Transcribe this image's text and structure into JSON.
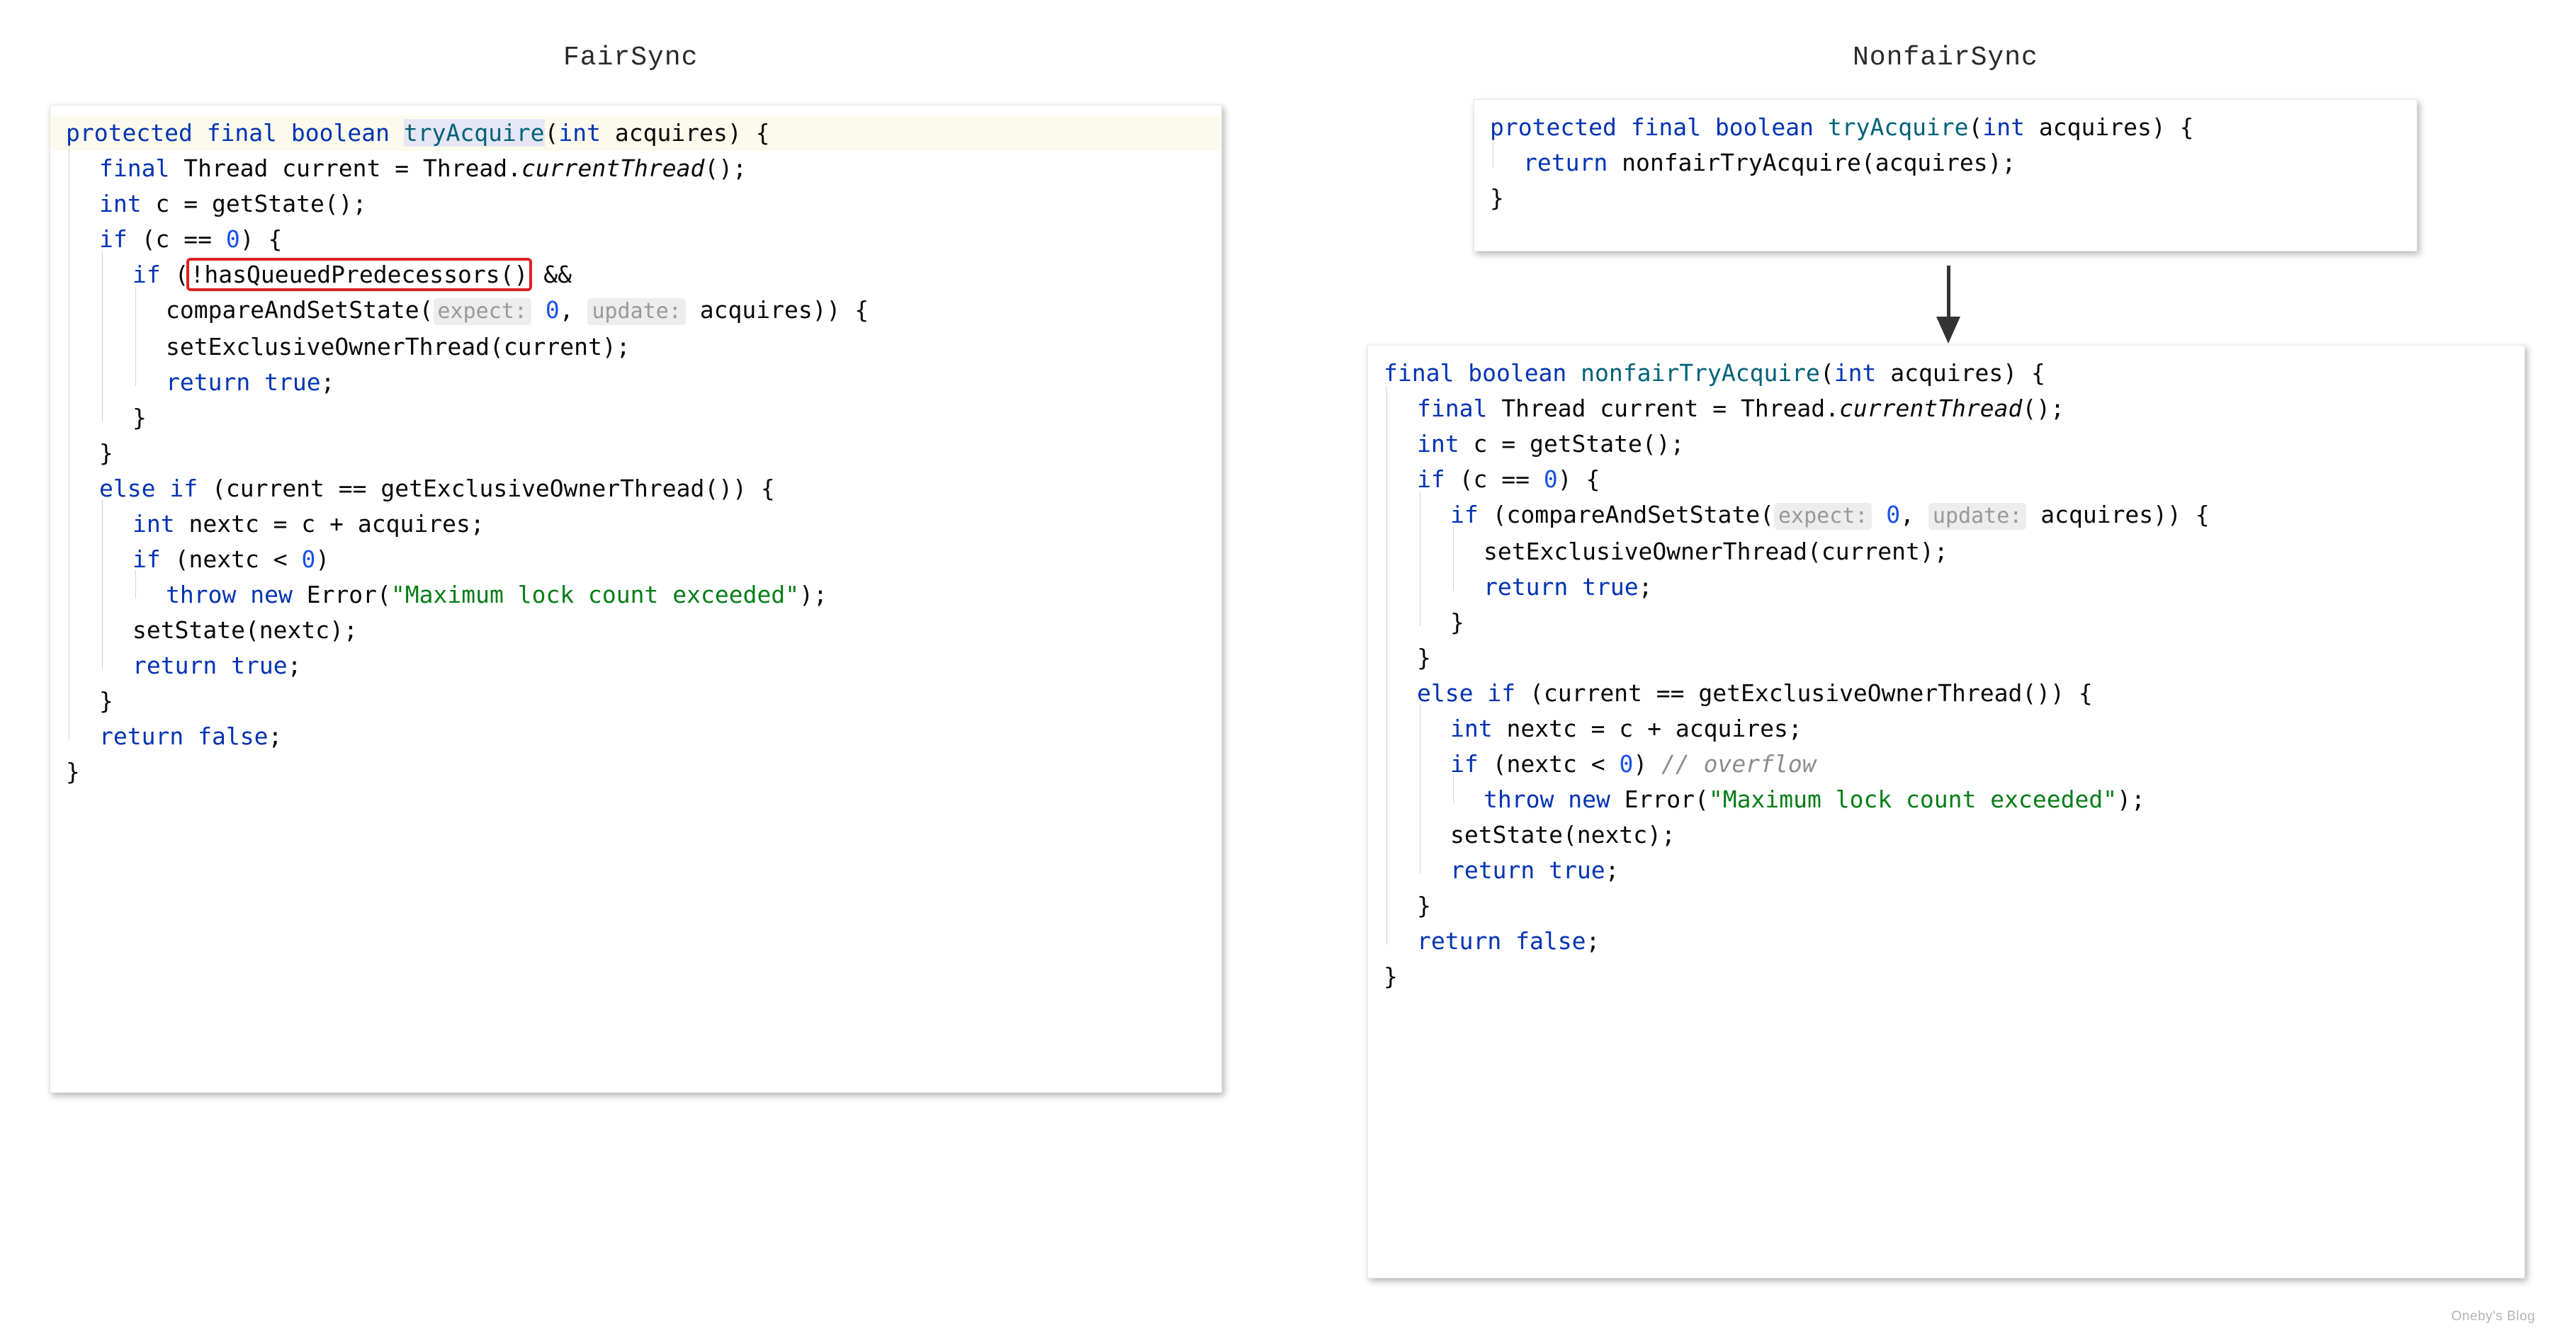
{
  "page": {
    "watermark": "Oneby's Blog",
    "colors": {
      "keyword": "#0033b3",
      "method": "#00627a",
      "number": "#1750eb",
      "string": "#067d17",
      "comment": "#8c8c8c",
      "annotation_box": "#e02020",
      "line_highlight": "#fcfaec",
      "word_highlight": "#e6e6f5",
      "hint_background": "#ededed",
      "hint_text": "#999999",
      "arrow": "#333333",
      "page_background": "#ffffff"
    }
  },
  "left_panel": {
    "title": "FairSync",
    "code_lines": [
      {
        "highlight": true,
        "indent": 0,
        "tokens": [
          {
            "t": "protected",
            "c": "kw"
          },
          {
            "t": " ",
            "c": "plain"
          },
          {
            "t": "final",
            "c": "kw"
          },
          {
            "t": " ",
            "c": "plain"
          },
          {
            "t": "boolean",
            "c": "kw"
          },
          {
            "t": " ",
            "c": "plain"
          },
          {
            "t": "tryAcquire",
            "c": "meth",
            "hl": true
          },
          {
            "t": "(",
            "c": "plain"
          },
          {
            "t": "int",
            "c": "kw"
          },
          {
            "t": " acquires) {",
            "c": "plain"
          }
        ]
      },
      {
        "highlight": false,
        "indent": 1,
        "tokens": [
          {
            "t": "final",
            "c": "kw"
          },
          {
            "t": " Thread current = Thread.",
            "c": "plain"
          },
          {
            "t": "currentThread",
            "c": "plain",
            "italic": true
          },
          {
            "t": "();",
            "c": "plain"
          }
        ]
      },
      {
        "highlight": false,
        "indent": 1,
        "tokens": [
          {
            "t": "int",
            "c": "kw"
          },
          {
            "t": " c = getState();",
            "c": "plain"
          }
        ]
      },
      {
        "highlight": false,
        "indent": 1,
        "tokens": [
          {
            "t": "if",
            "c": "kw"
          },
          {
            "t": " (c == ",
            "c": "plain"
          },
          {
            "t": "0",
            "c": "num"
          },
          {
            "t": ") {",
            "c": "plain"
          }
        ]
      },
      {
        "highlight": false,
        "indent": 2,
        "tokens": [
          {
            "t": "if",
            "c": "kw"
          },
          {
            "t": " (",
            "c": "plain"
          },
          {
            "t": "!hasQueuedPredecessors()",
            "c": "plain",
            "redbox": true
          },
          {
            "t": " &&",
            "c": "plain"
          }
        ]
      },
      {
        "highlight": false,
        "indent": 3,
        "tokens": [
          {
            "t": "compareAndSetState(",
            "c": "plain"
          },
          {
            "t": "expect:",
            "c": "hint"
          },
          {
            "t": " ",
            "c": "plain"
          },
          {
            "t": "0",
            "c": "num"
          },
          {
            "t": ", ",
            "c": "plain"
          },
          {
            "t": "update:",
            "c": "hint"
          },
          {
            "t": " acquires)) {",
            "c": "plain"
          }
        ]
      },
      {
        "highlight": false,
        "indent": 3,
        "tokens": [
          {
            "t": "setExclusiveOwnerThread(current);",
            "c": "plain"
          }
        ]
      },
      {
        "highlight": false,
        "indent": 3,
        "tokens": [
          {
            "t": "return",
            "c": "kw"
          },
          {
            "t": " ",
            "c": "plain"
          },
          {
            "t": "true",
            "c": "kw"
          },
          {
            "t": ";",
            "c": "plain"
          }
        ]
      },
      {
        "highlight": false,
        "indent": 2,
        "tokens": [
          {
            "t": "}",
            "c": "plain"
          }
        ]
      },
      {
        "highlight": false,
        "indent": 1,
        "tokens": [
          {
            "t": "}",
            "c": "plain"
          }
        ]
      },
      {
        "highlight": false,
        "indent": 1,
        "tokens": [
          {
            "t": "else",
            "c": "kw"
          },
          {
            "t": " ",
            "c": "plain"
          },
          {
            "t": "if",
            "c": "kw"
          },
          {
            "t": " (current == getExclusiveOwnerThread()) {",
            "c": "plain"
          }
        ]
      },
      {
        "highlight": false,
        "indent": 2,
        "tokens": [
          {
            "t": "int",
            "c": "kw"
          },
          {
            "t": " nextc = c + acquires;",
            "c": "plain"
          }
        ]
      },
      {
        "highlight": false,
        "indent": 2,
        "tokens": [
          {
            "t": "if",
            "c": "kw"
          },
          {
            "t": " (nextc < ",
            "c": "plain"
          },
          {
            "t": "0",
            "c": "num"
          },
          {
            "t": ")",
            "c": "plain"
          }
        ]
      },
      {
        "highlight": false,
        "indent": 3,
        "tokens": [
          {
            "t": "throw",
            "c": "kw"
          },
          {
            "t": " ",
            "c": "plain"
          },
          {
            "t": "new",
            "c": "kw"
          },
          {
            "t": " Error(",
            "c": "plain"
          },
          {
            "t": "\"Maximum lock count exceeded\"",
            "c": "str"
          },
          {
            "t": ");",
            "c": "plain"
          }
        ]
      },
      {
        "highlight": false,
        "indent": 2,
        "tokens": [
          {
            "t": "setState(nextc);",
            "c": "plain"
          }
        ]
      },
      {
        "highlight": false,
        "indent": 2,
        "tokens": [
          {
            "t": "return",
            "c": "kw"
          },
          {
            "t": " ",
            "c": "plain"
          },
          {
            "t": "true",
            "c": "kw"
          },
          {
            "t": ";",
            "c": "plain"
          }
        ]
      },
      {
        "highlight": false,
        "indent": 1,
        "tokens": [
          {
            "t": "}",
            "c": "plain"
          }
        ]
      },
      {
        "highlight": false,
        "indent": 1,
        "tokens": [
          {
            "t": "return",
            "c": "kw"
          },
          {
            "t": " ",
            "c": "plain"
          },
          {
            "t": "false",
            "c": "kw"
          },
          {
            "t": ";",
            "c": "plain"
          }
        ]
      },
      {
        "highlight": false,
        "indent": 0,
        "tokens": [
          {
            "t": "}",
            "c": "plain"
          }
        ]
      }
    ]
  },
  "right_panel": {
    "title": "NonfairSync",
    "top_card_lines": [
      {
        "highlight": false,
        "indent": 0,
        "tokens": [
          {
            "t": "protected",
            "c": "kw"
          },
          {
            "t": " ",
            "c": "plain"
          },
          {
            "t": "final",
            "c": "kw"
          },
          {
            "t": " ",
            "c": "plain"
          },
          {
            "t": "boolean",
            "c": "kw"
          },
          {
            "t": " ",
            "c": "plain"
          },
          {
            "t": "tryAcquire",
            "c": "meth"
          },
          {
            "t": "(",
            "c": "plain"
          },
          {
            "t": "int",
            "c": "kw"
          },
          {
            "t": " acquires) {",
            "c": "plain"
          }
        ]
      },
      {
        "highlight": false,
        "indent": 1,
        "tokens": [
          {
            "t": "return",
            "c": "kw"
          },
          {
            "t": " nonfairTryAcquire(acquires);",
            "c": "plain"
          }
        ]
      },
      {
        "highlight": false,
        "indent": 0,
        "tokens": [
          {
            "t": "}",
            "c": "plain"
          }
        ]
      }
    ],
    "bottom_card_lines": [
      {
        "highlight": false,
        "indent": 0,
        "tokens": [
          {
            "t": "final",
            "c": "kw"
          },
          {
            "t": " ",
            "c": "plain"
          },
          {
            "t": "boolean",
            "c": "kw"
          },
          {
            "t": " ",
            "c": "plain"
          },
          {
            "t": "nonfairTryAcquire",
            "c": "meth"
          },
          {
            "t": "(",
            "c": "plain"
          },
          {
            "t": "int",
            "c": "kw"
          },
          {
            "t": " acquires) {",
            "c": "plain"
          }
        ]
      },
      {
        "highlight": false,
        "indent": 1,
        "tokens": [
          {
            "t": "final",
            "c": "kw"
          },
          {
            "t": " Thread current = Thread.",
            "c": "plain"
          },
          {
            "t": "currentThread",
            "c": "plain",
            "italic": true
          },
          {
            "t": "();",
            "c": "plain"
          }
        ]
      },
      {
        "highlight": false,
        "indent": 1,
        "tokens": [
          {
            "t": "int",
            "c": "kw"
          },
          {
            "t": " c = getState();",
            "c": "plain"
          }
        ]
      },
      {
        "highlight": false,
        "indent": 1,
        "tokens": [
          {
            "t": "if",
            "c": "kw"
          },
          {
            "t": " (c == ",
            "c": "plain"
          },
          {
            "t": "0",
            "c": "num"
          },
          {
            "t": ") {",
            "c": "plain"
          }
        ]
      },
      {
        "highlight": false,
        "indent": 2,
        "tokens": [
          {
            "t": "if",
            "c": "kw"
          },
          {
            "t": " (compareAndSetState(",
            "c": "plain"
          },
          {
            "t": "expect:",
            "c": "hint"
          },
          {
            "t": " ",
            "c": "plain"
          },
          {
            "t": "0",
            "c": "num"
          },
          {
            "t": ", ",
            "c": "plain"
          },
          {
            "t": "update:",
            "c": "hint"
          },
          {
            "t": " acquires)) {",
            "c": "plain"
          }
        ]
      },
      {
        "highlight": false,
        "indent": 3,
        "tokens": [
          {
            "t": "setExclusiveOwnerThread(current);",
            "c": "plain"
          }
        ]
      },
      {
        "highlight": false,
        "indent": 3,
        "tokens": [
          {
            "t": "return",
            "c": "kw"
          },
          {
            "t": " ",
            "c": "plain"
          },
          {
            "t": "true",
            "c": "kw"
          },
          {
            "t": ";",
            "c": "plain"
          }
        ]
      },
      {
        "highlight": false,
        "indent": 2,
        "tokens": [
          {
            "t": "}",
            "c": "plain"
          }
        ]
      },
      {
        "highlight": false,
        "indent": 1,
        "tokens": [
          {
            "t": "}",
            "c": "plain"
          }
        ]
      },
      {
        "highlight": false,
        "indent": 1,
        "tokens": [
          {
            "t": "else",
            "c": "kw"
          },
          {
            "t": " ",
            "c": "plain"
          },
          {
            "t": "if",
            "c": "kw"
          },
          {
            "t": " (current == getExclusiveOwnerThread()) {",
            "c": "plain"
          }
        ]
      },
      {
        "highlight": false,
        "indent": 2,
        "tokens": [
          {
            "t": "int",
            "c": "kw"
          },
          {
            "t": " nextc = c + acquires;",
            "c": "plain"
          }
        ]
      },
      {
        "highlight": false,
        "indent": 2,
        "tokens": [
          {
            "t": "if",
            "c": "kw"
          },
          {
            "t": " (nextc < ",
            "c": "plain"
          },
          {
            "t": "0",
            "c": "num"
          },
          {
            "t": ") ",
            "c": "plain"
          },
          {
            "t": "// overflow",
            "c": "cmt"
          }
        ]
      },
      {
        "highlight": false,
        "indent": 3,
        "tokens": [
          {
            "t": "throw",
            "c": "kw"
          },
          {
            "t": " ",
            "c": "plain"
          },
          {
            "t": "new",
            "c": "kw"
          },
          {
            "t": " Error(",
            "c": "plain"
          },
          {
            "t": "\"Maximum lock count exceeded\"",
            "c": "str"
          },
          {
            "t": ");",
            "c": "plain"
          }
        ]
      },
      {
        "highlight": false,
        "indent": 2,
        "tokens": [
          {
            "t": "setState(nextc);",
            "c": "plain"
          }
        ]
      },
      {
        "highlight": false,
        "indent": 2,
        "tokens": [
          {
            "t": "return",
            "c": "kw"
          },
          {
            "t": " ",
            "c": "plain"
          },
          {
            "t": "true",
            "c": "kw"
          },
          {
            "t": ";",
            "c": "plain"
          }
        ]
      },
      {
        "highlight": false,
        "indent": 1,
        "tokens": [
          {
            "t": "}",
            "c": "plain"
          }
        ]
      },
      {
        "highlight": false,
        "indent": 1,
        "tokens": [
          {
            "t": "return",
            "c": "kw"
          },
          {
            "t": " ",
            "c": "plain"
          },
          {
            "t": "false",
            "c": "kw"
          },
          {
            "t": ";",
            "c": "plain"
          }
        ]
      },
      {
        "highlight": false,
        "indent": 0,
        "tokens": [
          {
            "t": "}",
            "c": "plain"
          }
        ]
      }
    ],
    "flow_arrow": "down-arrow"
  }
}
